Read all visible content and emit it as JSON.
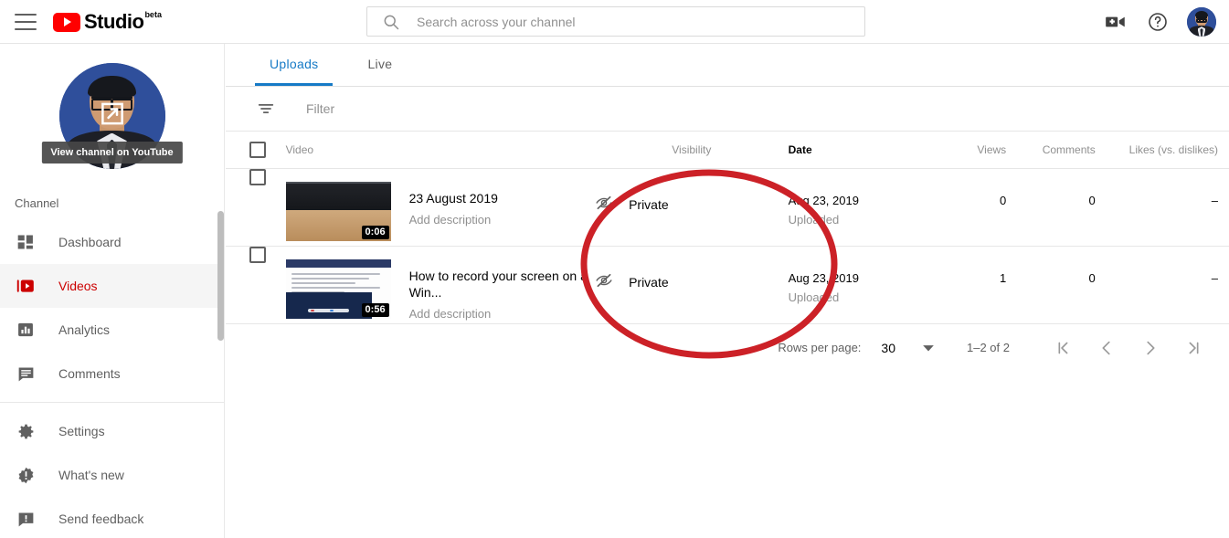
{
  "header": {
    "menu_icon": "hamburger-menu-icon",
    "logo_text": "Studio",
    "logo_badge": "beta",
    "logo_icon": "youtube-play-icon",
    "search": {
      "icon": "search-icon",
      "placeholder": "Search across your channel",
      "value": ""
    },
    "create_icon": "video-camera-plus-icon",
    "help_icon": "help-circle-icon",
    "avatar_icon": "account-avatar"
  },
  "sidebar": {
    "avatar_overlay_icon": "open-in-new-icon",
    "tooltip": "View channel on YouTube",
    "section_label": "Channel",
    "items": [
      {
        "label": "Dashboard",
        "icon": "dashboard-grid-icon",
        "active": false
      },
      {
        "label": "Videos",
        "icon": "video-library-icon",
        "active": true
      },
      {
        "label": "Analytics",
        "icon": "bar-chart-icon",
        "active": false
      },
      {
        "label": "Comments",
        "icon": "comment-bubble-icon",
        "active": false
      }
    ],
    "secondary_items": [
      {
        "label": "Settings",
        "icon": "gear-icon"
      },
      {
        "label": "What's new",
        "icon": "new-releases-icon"
      },
      {
        "label": "Send feedback",
        "icon": "feedback-icon"
      }
    ]
  },
  "main": {
    "tabs": [
      {
        "label": "Uploads",
        "active": true
      },
      {
        "label": "Live",
        "active": false
      }
    ],
    "filter": {
      "icon": "filter-icon",
      "placeholder": "Filter",
      "value": ""
    },
    "table": {
      "columns": [
        {
          "label": "Video",
          "sorted": false
        },
        {
          "label": "Visibility",
          "sorted": false
        },
        {
          "label": "Date",
          "sorted": true
        },
        {
          "label": "Views",
          "sorted": false
        },
        {
          "label": "Comments",
          "sorted": false
        },
        {
          "label": "Likes (vs. dislikes)",
          "sorted": false
        }
      ],
      "rows": [
        {
          "title": "23 August 2019",
          "description": "Add description",
          "duration": "0:06",
          "visibility": "Private",
          "visibility_icon": "eye-off-icon",
          "date": "Aug 23, 2019",
          "date_status": "Uploaded",
          "views": "0",
          "comments": "0",
          "likes": "–"
        },
        {
          "title": "How to record your screen on a Win...",
          "description": "Add description",
          "duration": "0:56",
          "visibility": "Private",
          "visibility_icon": "eye-off-icon",
          "date": "Aug 23, 2019",
          "date_status": "Uploaded",
          "views": "1",
          "comments": "0",
          "likes": "–"
        }
      ]
    },
    "pagination": {
      "rows_per_page_label": "Rows per page:",
      "rows_per_page_value": "30",
      "dropdown_icon": "caret-down-icon",
      "range": "1–2 of 2",
      "first_page_icon": "first-page-icon",
      "prev_page_icon": "previous-page-icon",
      "next_page_icon": "next-page-icon",
      "last_page_icon": "last-page-icon"
    }
  },
  "annotation": {
    "shape": "ellipse-highlight",
    "color": "#CC2127",
    "target": "Visibility column"
  },
  "colors": {
    "brand_red": "#FF0000",
    "active_red": "#CC0000",
    "tab_blue": "#167AC6",
    "text_primary": "#030303",
    "text_secondary": "#606060",
    "text_muted": "#909090",
    "annotation_red": "#CC2127"
  }
}
